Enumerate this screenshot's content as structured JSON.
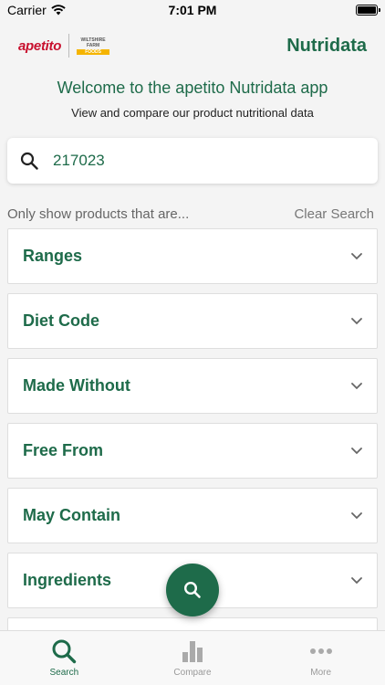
{
  "status_bar": {
    "carrier": "Carrier",
    "time": "7:01 PM"
  },
  "header": {
    "brand_logo_text": "apetito",
    "partner_logo_lines": [
      "WILTSHIRE",
      "FARM",
      "FOODS"
    ],
    "app_title": "Nutridata"
  },
  "welcome": {
    "title": "Welcome to the apetito Nutridata app",
    "subtitle": "View and compare our product nutritional data"
  },
  "search": {
    "value": "217023"
  },
  "filters": {
    "prompt": "Only show products that are...",
    "clear_label": "Clear Search",
    "items": [
      {
        "label": "Ranges"
      },
      {
        "label": "Diet Code"
      },
      {
        "label": "Made Without"
      },
      {
        "label": "Free From"
      },
      {
        "label": "May Contain"
      },
      {
        "label": "Ingredients"
      }
    ]
  },
  "tabs": [
    {
      "label": "Search",
      "icon": "search-icon",
      "active": true
    },
    {
      "label": "Compare",
      "icon": "bar-chart-icon",
      "active": false
    },
    {
      "label": "More",
      "icon": "more-dots-icon",
      "active": false
    }
  ],
  "colors": {
    "brand_green": "#1e6b4a",
    "brand_red": "#c8102e",
    "partner_yellow": "#f5b400"
  }
}
